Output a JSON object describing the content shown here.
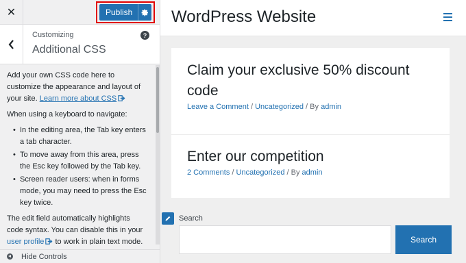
{
  "topbar": {
    "close_glyph": "✕",
    "publish_label": "Publish"
  },
  "section": {
    "crumb": "Customizing",
    "title": "Additional CSS",
    "help_glyph": "?"
  },
  "description": {
    "p1_text": "Add your own CSS code here to customize the appearance and layout of your site.",
    "p1_link": "Learn more about CSS",
    "p2": "When using a keyboard to navigate:",
    "bullets": [
      "In the editing area, the Tab key enters a tab character.",
      "To move away from this area, press the Esc key followed by the Tab key.",
      "Screen reader users: when in forms mode, you may need to press the Esc key twice."
    ],
    "p3_before": "The edit field automatically highlights code syntax. You can disable this in your ",
    "p3_link": "user profile",
    "p3_after": " to work in plain text mode."
  },
  "footer": {
    "hide_controls": "Hide Controls"
  },
  "site": {
    "title": "WordPress Website",
    "posts": [
      {
        "title": "Claim your exclusive 50% discount code",
        "comments": "Leave a Comment",
        "category": "Uncategorized",
        "by": "By",
        "author": "admin"
      },
      {
        "title": "Enter our competition",
        "comments": "2 Comments",
        "category": "Uncategorized",
        "by": "By",
        "author": "admin"
      }
    ],
    "meta_sep": " / ",
    "search": {
      "label": "Search",
      "placeholder": "",
      "button": "Search"
    }
  },
  "colors": {
    "accent": "#2271b1",
    "highlight_border": "#e10000"
  },
  "icons": {
    "close": "close-icon",
    "settings": "gear-icon",
    "back": "chevron-left-icon",
    "help": "help-icon",
    "external": "external-link-icon",
    "hide": "collapse-icon",
    "menu": "hamburger-menu-icon",
    "edit": "pencil-icon"
  }
}
